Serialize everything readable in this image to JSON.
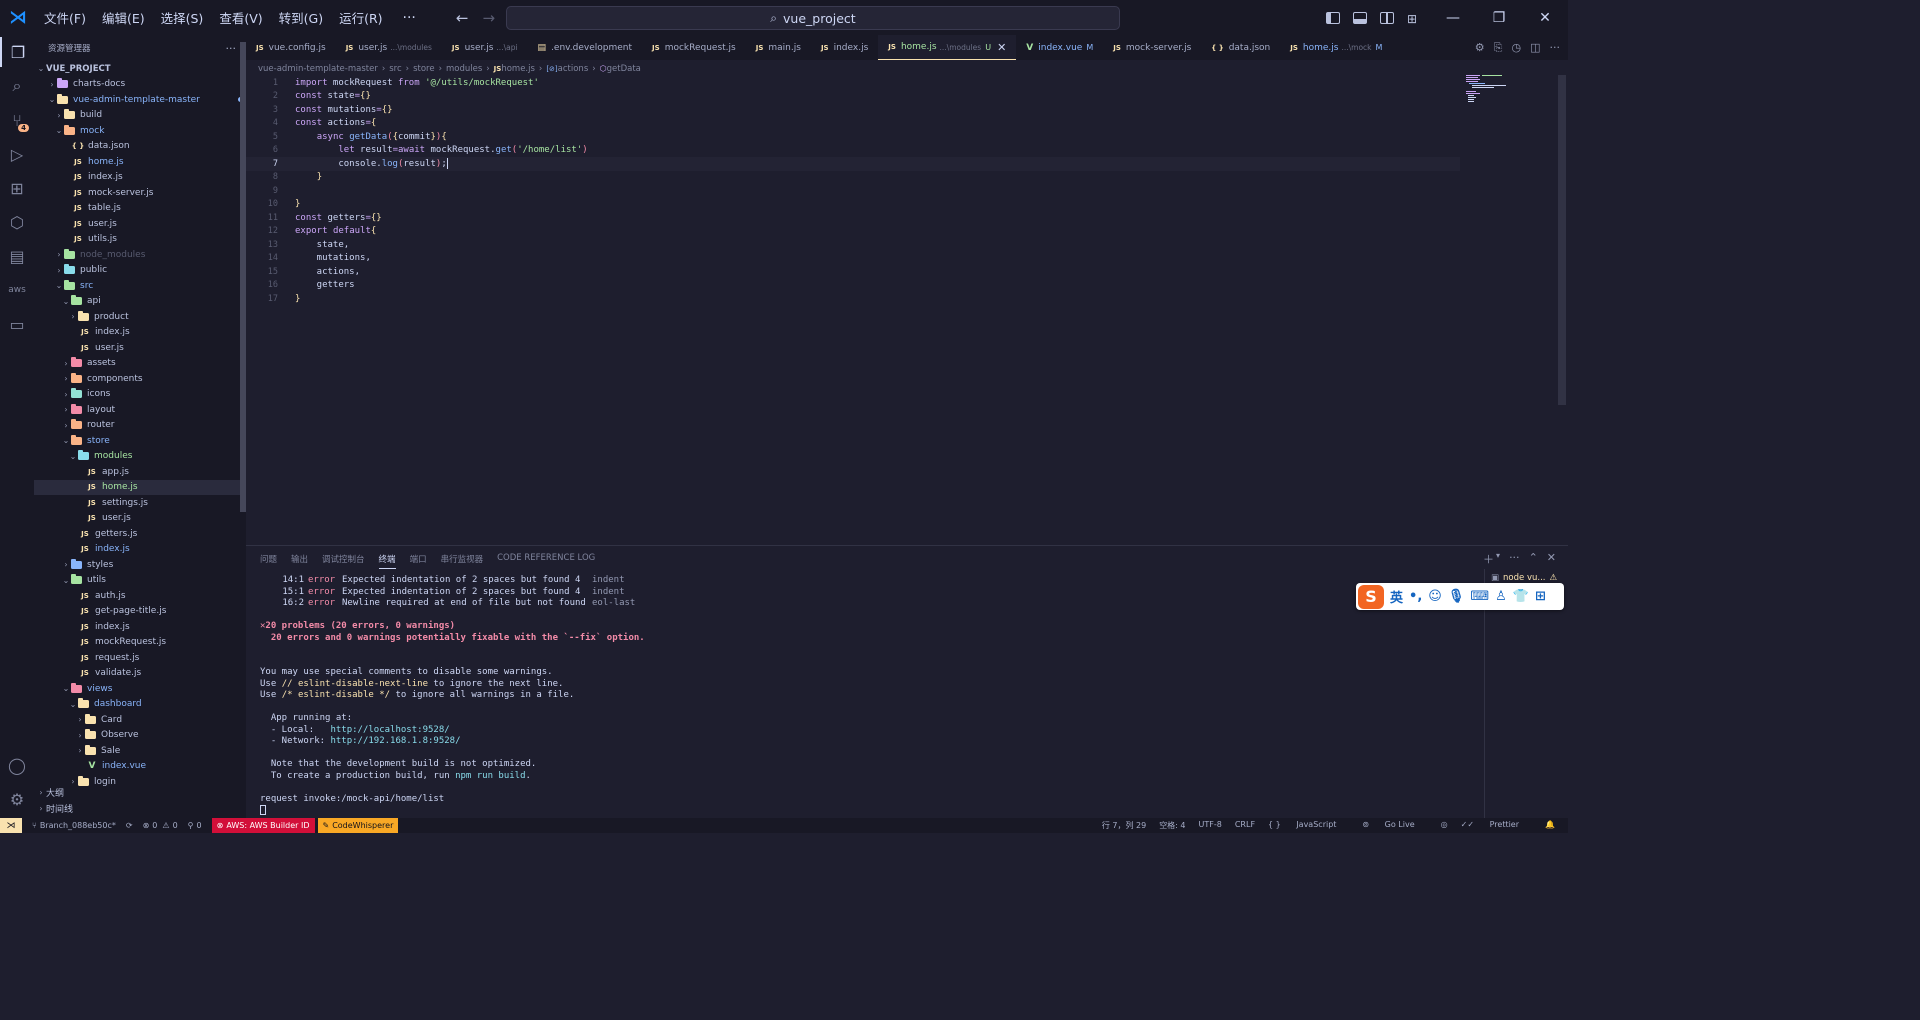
{
  "titlebar": {
    "menus": [
      "文件(F)",
      "编辑(E)",
      "选择(S)",
      "查看(V)",
      "转到(G)",
      "运行(R)"
    ],
    "more": "···",
    "search": "vue_project"
  },
  "activity": {
    "scm_badge": "4"
  },
  "sidebar": {
    "header": "资源管理器",
    "more": "···",
    "items": [
      {
        "label": "VUE_PROJECT",
        "depth": 0,
        "kind": "root",
        "open": true
      },
      {
        "label": "charts-docs",
        "depth": 1,
        "kind": "folder",
        "open": false
      },
      {
        "label": "vue-admin-template-master",
        "depth": 1,
        "kind": "folder",
        "open": true,
        "dot": "#89b4fa",
        "color": "#89b4fa"
      },
      {
        "label": "build",
        "depth": 2,
        "kind": "folder",
        "open": false
      },
      {
        "label": "mock",
        "depth": 2,
        "kind": "folder",
        "open": true,
        "dot": "#89b4fa",
        "color": "#89b4fa"
      },
      {
        "label": "data.json",
        "depth": 3,
        "kind": "json"
      },
      {
        "label": "home.js",
        "depth": 3,
        "kind": "js",
        "status": "M",
        "color": "#89b4fa"
      },
      {
        "label": "index.js",
        "depth": 3,
        "kind": "js"
      },
      {
        "label": "mock-server.js",
        "depth": 3,
        "kind": "js"
      },
      {
        "label": "table.js",
        "depth": 3,
        "kind": "js"
      },
      {
        "label": "user.js",
        "depth": 3,
        "kind": "js"
      },
      {
        "label": "utils.js",
        "depth": 3,
        "kind": "js"
      },
      {
        "label": "node_modules",
        "depth": 2,
        "kind": "folder",
        "open": false,
        "color": "#585b70"
      },
      {
        "label": "public",
        "depth": 2,
        "kind": "folder",
        "open": false
      },
      {
        "label": "src",
        "depth": 2,
        "kind": "folder",
        "open": true,
        "dot": "#89b4fa",
        "color": "#89b4fa"
      },
      {
        "label": "api",
        "depth": 3,
        "kind": "folder",
        "open": true
      },
      {
        "label": "product",
        "depth": 4,
        "kind": "folder",
        "open": false
      },
      {
        "label": "index.js",
        "depth": 4,
        "kind": "js"
      },
      {
        "label": "user.js",
        "depth": 4,
        "kind": "js"
      },
      {
        "label": "assets",
        "depth": 3,
        "kind": "folder",
        "open": false
      },
      {
        "label": "components",
        "depth": 3,
        "kind": "folder",
        "open": false
      },
      {
        "label": "icons",
        "depth": 3,
        "kind": "folder",
        "open": false
      },
      {
        "label": "layout",
        "depth": 3,
        "kind": "folder",
        "open": false
      },
      {
        "label": "router",
        "depth": 3,
        "kind": "folder",
        "open": false
      },
      {
        "label": "store",
        "depth": 3,
        "kind": "folder",
        "open": true,
        "dot": "#89b4fa",
        "color": "#89b4fa"
      },
      {
        "label": "modules",
        "depth": 4,
        "kind": "folder",
        "open": true,
        "dot": "#a6e3a1",
        "color": "#a6e3a1"
      },
      {
        "label": "app.js",
        "depth": 5,
        "kind": "js"
      },
      {
        "label": "home.js",
        "depth": 5,
        "kind": "js",
        "status": "U",
        "color": "#a6e3a1",
        "selected": true
      },
      {
        "label": "settings.js",
        "depth": 5,
        "kind": "js"
      },
      {
        "label": "user.js",
        "depth": 5,
        "kind": "js"
      },
      {
        "label": "getters.js",
        "depth": 4,
        "kind": "js"
      },
      {
        "label": "index.js",
        "depth": 4,
        "kind": "js",
        "status": "M",
        "color": "#89b4fa"
      },
      {
        "label": "styles",
        "depth": 3,
        "kind": "folder",
        "open": false
      },
      {
        "label": "utils",
        "depth": 3,
        "kind": "folder",
        "open": true
      },
      {
        "label": "auth.js",
        "depth": 4,
        "kind": "js"
      },
      {
        "label": "get-page-title.js",
        "depth": 4,
        "kind": "js"
      },
      {
        "label": "index.js",
        "depth": 4,
        "kind": "js"
      },
      {
        "label": "mockRequest.js",
        "depth": 4,
        "kind": "js"
      },
      {
        "label": "request.js",
        "depth": 4,
        "kind": "js"
      },
      {
        "label": "validate.js",
        "depth": 4,
        "kind": "js"
      },
      {
        "label": "views",
        "depth": 3,
        "kind": "folder",
        "open": true,
        "dot": "#89b4fa",
        "color": "#89b4fa"
      },
      {
        "label": "dashboard",
        "depth": 4,
        "kind": "folder",
        "open": true,
        "dot": "#89b4fa",
        "color": "#89b4fa"
      },
      {
        "label": "Card",
        "depth": 5,
        "kind": "folder",
        "open": false
      },
      {
        "label": "Observe",
        "depth": 5,
        "kind": "folder",
        "open": false
      },
      {
        "label": "Sale",
        "depth": 5,
        "kind": "folder",
        "open": false
      },
      {
        "label": "index.vue",
        "depth": 5,
        "kind": "vue",
        "status": "M",
        "color": "#89b4fa"
      },
      {
        "label": "login",
        "depth": 4,
        "kind": "folder",
        "open": false
      }
    ],
    "outline": "大纲",
    "timeline": "时间线"
  },
  "tabs": [
    {
      "label": "vue.config.js",
      "kind": "js"
    },
    {
      "label": "user.js",
      "desc": "...\\modules",
      "kind": "js"
    },
    {
      "label": "user.js",
      "desc": "...\\api",
      "kind": "js"
    },
    {
      "label": ".env.development",
      "kind": "env"
    },
    {
      "label": "mockRequest.js",
      "kind": "js"
    },
    {
      "label": "main.js",
      "kind": "js"
    },
    {
      "label": "index.js",
      "kind": "js"
    },
    {
      "label": "home.js",
      "desc": "...\\modules",
      "mark": "U",
      "kind": "js",
      "active": true
    },
    {
      "label": "index.vue",
      "mark": "M",
      "kind": "vue",
      "color": "#89b4fa"
    },
    {
      "label": "mock-server.js",
      "kind": "js"
    },
    {
      "label": "data.json",
      "kind": "json"
    },
    {
      "label": "home.js",
      "desc": "...\\mock",
      "mark": "M",
      "kind": "js",
      "color": "#89b4fa"
    }
  ],
  "breadcrumb": [
    "vue-admin-template-master",
    "src",
    "store",
    "modules",
    "home.js",
    "actions",
    "getData"
  ],
  "code": {
    "current_line": 7,
    "lines": [
      [
        [
          "k",
          "import"
        ],
        [
          "n",
          " mockRequest "
        ],
        [
          "k",
          "from"
        ],
        [
          "n",
          " "
        ],
        [
          "s",
          "'@/utils/mockRequest'"
        ]
      ],
      [
        [
          "k",
          "const"
        ],
        [
          "n",
          " state"
        ],
        [
          "k",
          "="
        ],
        [
          "p",
          "{}"
        ]
      ],
      [
        [
          "k",
          "const"
        ],
        [
          "n",
          " mutations"
        ],
        [
          "k",
          "="
        ],
        [
          "p",
          "{}"
        ]
      ],
      [
        [
          "k",
          "const"
        ],
        [
          "n",
          " actions"
        ],
        [
          "k",
          "="
        ],
        [
          "p",
          "{"
        ]
      ],
      [
        [
          "n",
          "    "
        ],
        [
          "k",
          "async"
        ],
        [
          "n",
          " "
        ],
        [
          "f",
          "getData"
        ],
        [
          "v",
          "("
        ],
        [
          "p",
          "{"
        ],
        [
          "n",
          "commit"
        ],
        [
          "p",
          "}"
        ],
        [
          "v",
          ")"
        ],
        [
          "p",
          "{"
        ]
      ],
      [
        [
          "n",
          "        "
        ],
        [
          "k",
          "let"
        ],
        [
          "n",
          " result"
        ],
        [
          "k",
          "="
        ],
        [
          "k",
          "await"
        ],
        [
          "n",
          " mockRequest."
        ],
        [
          "f",
          "get"
        ],
        [
          "v",
          "("
        ],
        [
          "s",
          "'/home/list'"
        ],
        [
          "v",
          ")"
        ]
      ],
      [
        [
          "n",
          "        console."
        ],
        [
          "f",
          "log"
        ],
        [
          "v",
          "("
        ],
        [
          "n",
          "result"
        ],
        [
          "v",
          ")"
        ],
        [
          "n",
          ";"
        ]
      ],
      [
        [
          "n",
          "    "
        ],
        [
          "p",
          "}"
        ]
      ],
      [
        [
          "n",
          ""
        ]
      ],
      [
        [
          "p",
          "}"
        ]
      ],
      [
        [
          "k",
          "const"
        ],
        [
          "n",
          " getters"
        ],
        [
          "k",
          "="
        ],
        [
          "p",
          "{}"
        ]
      ],
      [
        [
          "k",
          "export"
        ],
        [
          "n",
          " "
        ],
        [
          "k",
          "default"
        ],
        [
          "p",
          "{"
        ]
      ],
      [
        [
          "n",
          "    state,"
        ]
      ],
      [
        [
          "n",
          "    mutations,"
        ]
      ],
      [
        [
          "n",
          "    actions,"
        ]
      ],
      [
        [
          "n",
          "    getters"
        ]
      ],
      [
        [
          "p",
          "}"
        ]
      ]
    ]
  },
  "panel": {
    "tabs": [
      "问题",
      "输出",
      "调试控制台",
      "终端",
      "端口",
      "串行监视器",
      "CODE REFERENCE LOG"
    ],
    "active_tab": "终端",
    "terminal_name": "node vu...",
    "terminal": {
      "errors": [
        {
          "pos": "14:1",
          "level": "error",
          "msg": "Expected indentation of 2 spaces but found 4",
          "rule": "indent"
        },
        {
          "pos": "15:1",
          "level": "error",
          "msg": "Expected indentation of 2 spaces but found 4",
          "rule": "indent"
        },
        {
          "pos": "16:2",
          "level": "error",
          "msg": "Newline required at end of file but not found",
          "rule": "eol-last"
        }
      ],
      "problems": "20 problems (20 errors, 0 warnings)",
      "fixable": "20 errors and 0 warnings potentially fixable with the `--fix` option.",
      "hint_intro": "You may use special comments to disable some warnings.",
      "hint1_pre": "Use ",
      "hint1_code": "// eslint-disable-next-line",
      "hint1_post": " to ignore the next line.",
      "hint2_pre": "Use ",
      "hint2_code": "/* eslint-disable */",
      "hint2_post": " to ignore all warnings in a file.",
      "running": "App running at:",
      "local_label": "- Local:   ",
      "local_url": "http://localhost:9528/",
      "network_label": "- Network: ",
      "network_url": "http://192.168.1.8:9528/",
      "note1": "Note that the development build is not optimized.",
      "note2_pre": "To create a production build, run ",
      "note2_cmd": "npm run build",
      "note2_post": ".",
      "invoke": "request invoke:/mock-api/home/list"
    }
  },
  "ime": {
    "mode": "英"
  },
  "statusbar": {
    "branch": "Branch_088eb50c*",
    "errors": "0",
    "warnings": "0",
    "ports": "0",
    "aws": "AWS: AWS Builder ID",
    "codewhisperer": "CodeWhisperer",
    "position": "行 7，列 29",
    "spaces": "空格: 4",
    "encoding": "UTF-8",
    "eol": "CRLF",
    "language": "JavaScript",
    "golive": "Go Live",
    "prettier": "Prettier"
  }
}
